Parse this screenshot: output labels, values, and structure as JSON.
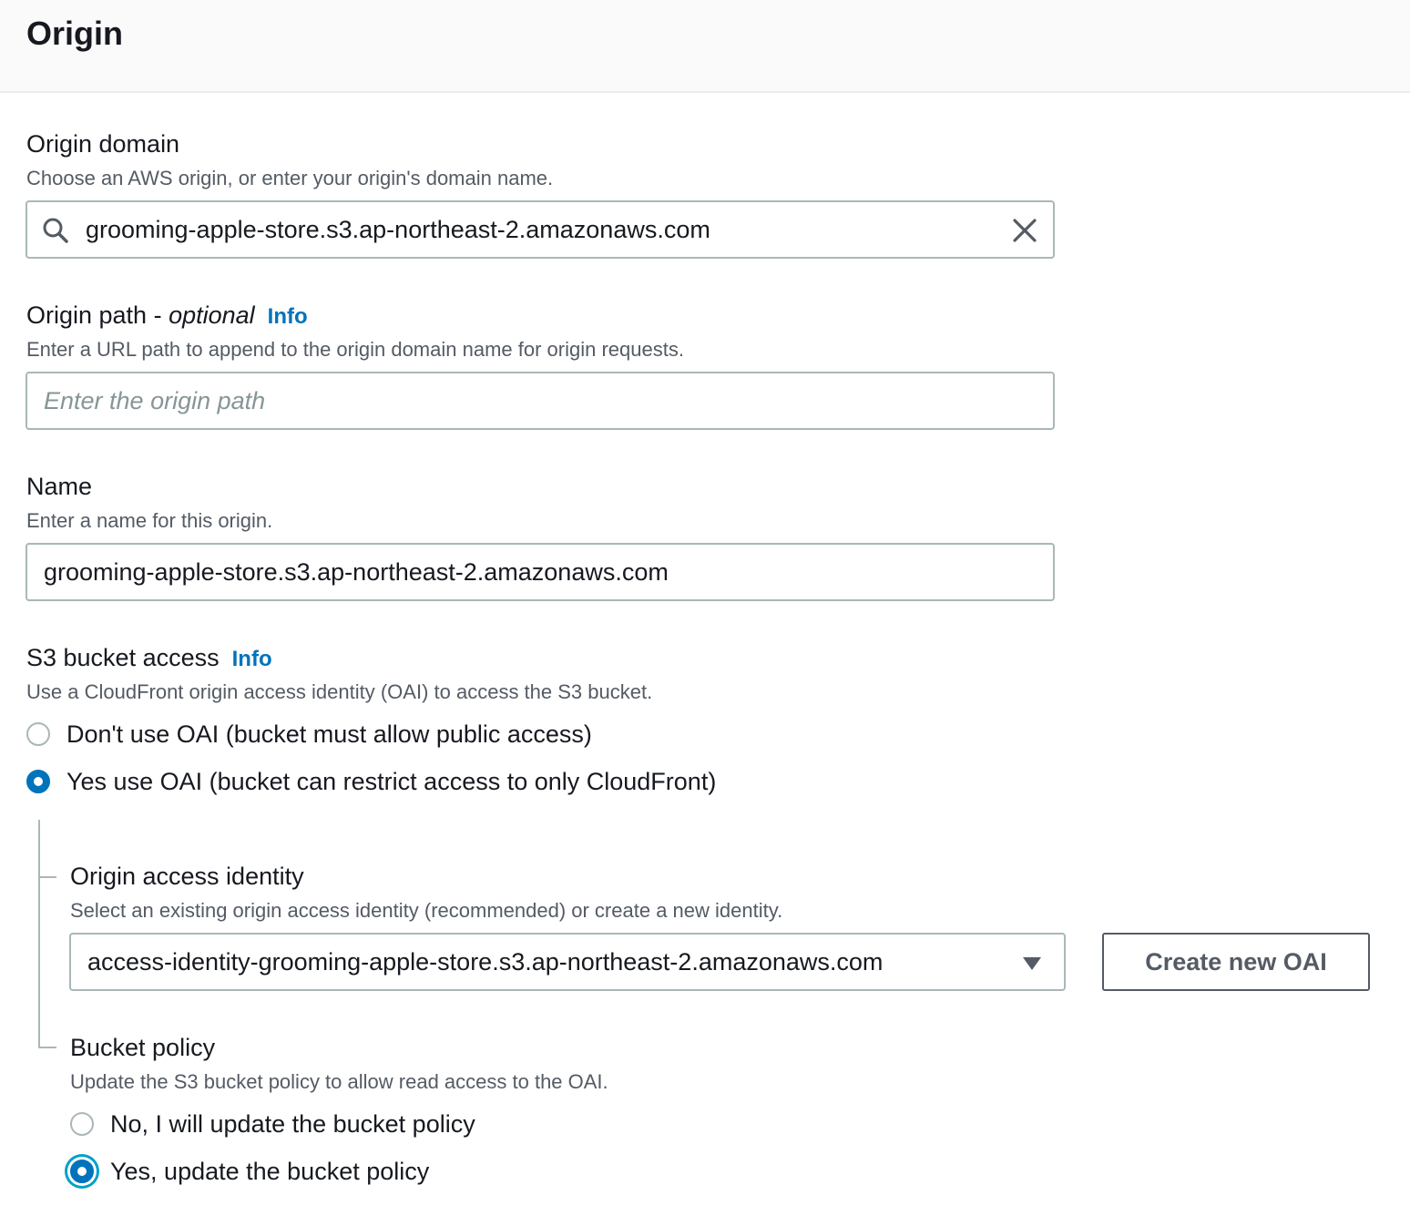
{
  "header": {
    "title": "Origin"
  },
  "origin_domain": {
    "label": "Origin domain",
    "description": "Choose an AWS origin, or enter your origin's domain name.",
    "value": "grooming-apple-store.s3.ap-northeast-2.amazonaws.com",
    "search_icon": "search-icon",
    "clear_icon": "close-icon"
  },
  "origin_path": {
    "label": "Origin path - ",
    "label_optional": "optional",
    "info": "Info",
    "description": "Enter a URL path to append to the origin domain name for origin requests.",
    "placeholder": "Enter the origin path",
    "value": ""
  },
  "name": {
    "label": "Name",
    "description": "Enter a name for this origin.",
    "value": "grooming-apple-store.s3.ap-northeast-2.amazonaws.com"
  },
  "s3_bucket_access": {
    "label": "S3 bucket access",
    "info": "Info",
    "description": "Use a CloudFront origin access identity (OAI) to access the S3 bucket.",
    "options": [
      {
        "label": "Don't use OAI (bucket must allow public access)",
        "selected": false
      },
      {
        "label": "Yes use OAI (bucket can restrict access to only CloudFront)",
        "selected": true
      }
    ]
  },
  "origin_access_identity": {
    "label": "Origin access identity",
    "description": "Select an existing origin access identity (recommended) or create a new identity.",
    "selected_value": "access-identity-grooming-apple-store.s3.ap-northeast-2.amazonaws.com",
    "create_button": "Create new OAI"
  },
  "bucket_policy": {
    "label": "Bucket policy",
    "description": "Update the S3 bucket policy to allow read access to the OAI.",
    "options": [
      {
        "label": "No, I will update the bucket policy",
        "selected": false
      },
      {
        "label": "Yes, update the bucket policy",
        "selected": true
      }
    ]
  },
  "colors": {
    "accent": "#0073bb",
    "focus_ring": "#00a1c9",
    "border": "#aab7b8",
    "text": "#16191f",
    "secondary_text": "#545b64",
    "header_bg": "#fafafa"
  }
}
